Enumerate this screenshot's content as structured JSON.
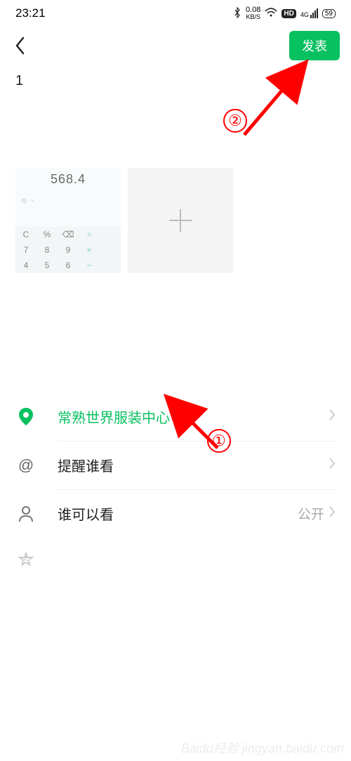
{
  "status": {
    "time": "23:21",
    "net_speed_value": "0.08",
    "net_speed_unit": "KB/S",
    "network_4g": "4G",
    "battery": "59"
  },
  "header": {
    "publish_label": "发表"
  },
  "compose": {
    "text": "1",
    "thumbnail_display": "568.4",
    "calc_keys": [
      "C",
      "%",
      "⌫",
      "÷",
      "",
      "7",
      "8",
      "9",
      "×",
      "",
      "4",
      "5",
      "6",
      "-",
      ""
    ]
  },
  "options": {
    "location": {
      "label": "常熟世界服装中心"
    },
    "mention": {
      "label": "提醒谁看"
    },
    "visibility": {
      "label": "谁可以看",
      "value": "公开"
    }
  },
  "annotations": {
    "step1": "①",
    "step2": "②"
  },
  "watermark": "Baidu经验 jingyan.baidu.com"
}
